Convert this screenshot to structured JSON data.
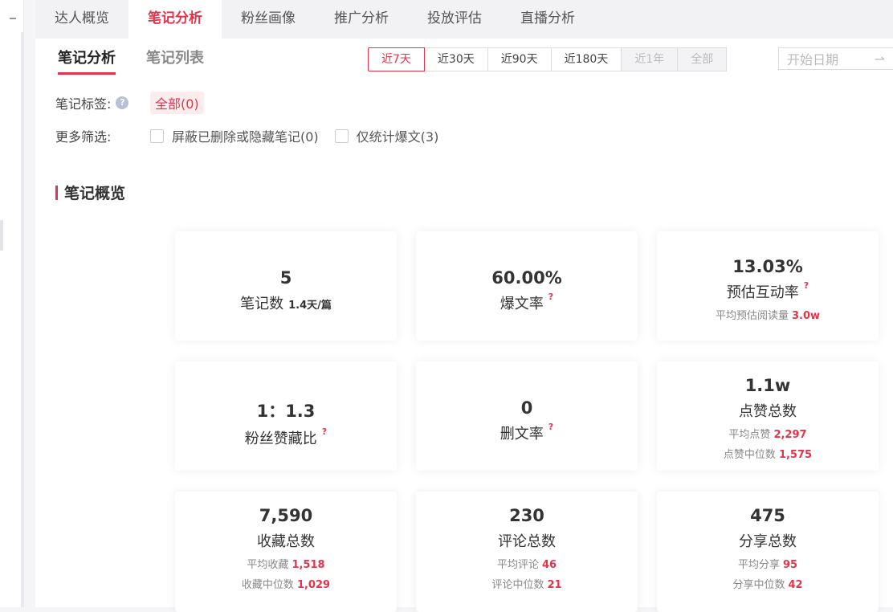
{
  "top_tabs": [
    "达人概览",
    "笔记分析",
    "粉丝画像",
    "推广分析",
    "投放评估",
    "直播分析"
  ],
  "sub_tabs": [
    "笔记分析",
    "笔记列表"
  ],
  "date_ranges": [
    "近7天",
    "近30天",
    "近90天",
    "近180天",
    "近1年",
    "全部"
  ],
  "date_input": {
    "placeholder": "开始日期",
    "arrow": "⇀"
  },
  "filters": {
    "tag_label": "笔记标签:",
    "tag_help": "?",
    "tag_value": "全部(0)",
    "more_label": "更多筛选:",
    "opt1": "屏蔽已删除或隐藏笔记(0)",
    "opt2": "仅统计爆文(3)"
  },
  "section_title": "笔记概览",
  "cards": {
    "notes": {
      "value": "5",
      "name": "笔记数",
      "extra": "1.4天/篇"
    },
    "viral": {
      "value": "60.00%",
      "name": "爆文率",
      "q": "?"
    },
    "engage": {
      "value": "13.03%",
      "name": "预估互动率",
      "q": "?",
      "sub_label": "平均预估阅读量",
      "sub_value": "3.0w"
    },
    "ratio": {
      "value": "1：1.3",
      "name": "粉丝赞藏比",
      "q": "?"
    },
    "deleted": {
      "value": "0",
      "name": "删文率",
      "q": "?"
    },
    "likes": {
      "value": "1.1w",
      "name": "点赞总数",
      "sub1_label": "平均点赞",
      "sub1_value": "2,297",
      "sub2_label": "点赞中位数",
      "sub2_value": "1,575"
    },
    "collects": {
      "value": "7,590",
      "name": "收藏总数",
      "sub1_label": "平均收藏",
      "sub1_value": "1,518",
      "sub2_label": "收藏中位数",
      "sub2_value": "1,029"
    },
    "comments": {
      "value": "230",
      "name": "评论总数",
      "sub1_label": "平均评论",
      "sub1_value": "46",
      "sub2_label": "评论中位数",
      "sub2_value": "21"
    },
    "shares": {
      "value": "475",
      "name": "分享总数",
      "sub1_label": "平均分享",
      "sub1_value": "95",
      "sub2_label": "分享中位数",
      "sub2_value": "42"
    }
  },
  "colors": {
    "accent": "#e5334b"
  }
}
